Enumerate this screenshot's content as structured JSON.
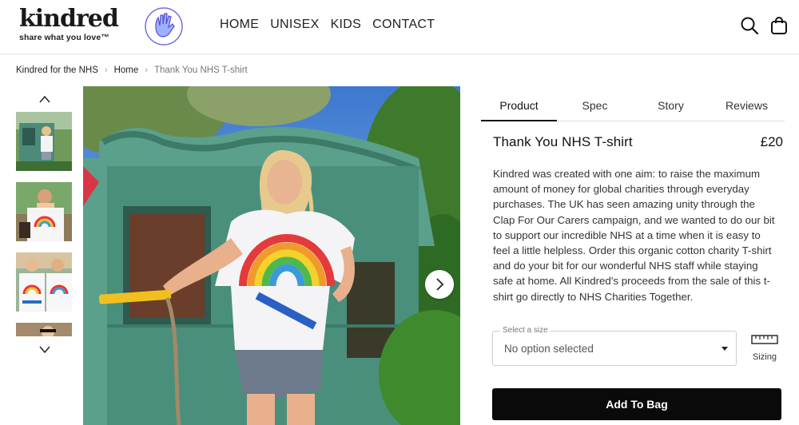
{
  "header": {
    "logo_text": "kindred",
    "tagline": "share what you love™",
    "badge_text": "#clapforourcarers",
    "nav": [
      "HOME",
      "UNISEX",
      "KIDS",
      "CONTACT"
    ],
    "search_icon": "search-icon",
    "bag_icon": "shopping-bag-icon"
  },
  "breadcrumb": {
    "items": [
      "Kindred for the NHS",
      "Home"
    ],
    "current": "Thank You NHS T-shirt"
  },
  "gallery": {
    "up_icon": "chevron-up-icon",
    "down_icon": "chevron-down-icon",
    "next_icon": "chevron-right-icon",
    "thumbnail_count": 4
  },
  "tabs": [
    "Product",
    "Spec",
    "Story",
    "Reviews"
  ],
  "active_tab": "Product",
  "product": {
    "title": "Thank You NHS T-shirt",
    "price": "£20",
    "description": "Kindred was created with one aim: to raise the maximum amount of money for global charities through everyday purchases. The UK has seen amazing unity through the Clap For Our Carers campaign, and we wanted to do our bit to support our incredible NHS at a time when it is easy to feel a little helpless. Order this organic cotton charity T-shirt and do your bit for our wonderful NHS staff while staying safe at home. All Kindred's proceeds from the sale of this t-shirt go directly to NHS Charities Together."
  },
  "size_select": {
    "label": "Select a size",
    "value": "No option selected"
  },
  "sizing": {
    "label": "Sizing",
    "icon": "ruler-icon"
  },
  "add_to_bag": "Add To Bag",
  "colors": {
    "button": "#0a0a0a",
    "badge": "#7b6fe0"
  }
}
